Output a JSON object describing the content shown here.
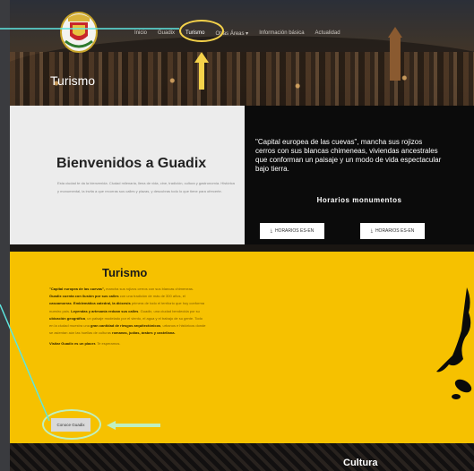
{
  "nav": {
    "items": [
      "Inicio",
      "Guadix",
      "Turismo",
      "Otras Áreas",
      "Información básica",
      "Actualidad"
    ],
    "active": "Turismo"
  },
  "hero": {
    "title": "Turismo"
  },
  "welcome": {
    "title": "Bienvenidos a Guadix",
    "text": "Esta ciudad te da la bienvenida. Ciudad milenaria, llena de vida, cine, tradición, cultura y gastronomía. Histórica y monumental, la invita a que recorras sus calles y plazas, y descubras todo lo que tiene para ofrecerte.",
    "quote": "\"Capital europea de las cuevas\", mancha sus rojizos cerros con sus blancas chimeneas, viviendas ancestrales que conforman un paisaje y un modo de vida espectacular bajo tierra.",
    "horarios_title": "Horarios monumentos",
    "button_es": "HORARIOS ES-EN",
    "button_en": "HORARIOS ES-EN"
  },
  "turismo": {
    "title": "Turismo",
    "para1_lead": "\"Capital europea de las cuevas\",",
    "para1_a": " mancha sus rojizos cerros con sus blancas chimeneas. ",
    "para1_b": "Guadix cuenta con ilusión por sus calles",
    "para1_c": " con una tradición de más de 300 años, el ",
    "para1_d": "cascamorras",
    "para1_e": ". ",
    "para1_f": "Emblemática catedral, la diócesis",
    "para1_g": " primera de todo el territorio que hoy conforma nuestro país. ",
    "para1_h": "Leyendas y artesanía redoan sus calles",
    "para1_i": ". Guadix, una ciudad bendecida por su ",
    "para1_j": "ubicación geográfica",
    "para1_k": ", un paisaje modelado por el viento, el agua y el trabajo de su gente. Todo en la ciudad muestra una ",
    "para1_l": "gran cantidad de riesgos arquitectónicos",
    "para1_m": ", urbanos e históricos donde se asientan aún las huellas de culturas ",
    "para1_n": "romanas, judías, árabes y castellana.",
    "para2_a": "Visitar Guadix es un placer.",
    "para2_b": " Te esperamos.",
    "button": "Conoce Guadix"
  },
  "cultura": {
    "title": "Cultura"
  },
  "colors": {
    "accent_yellow": "#f6c100",
    "annotation_yellow": "#f5d24a",
    "annotation_green": "#bff0c0",
    "connector_cyan": "#5ee6e0"
  }
}
